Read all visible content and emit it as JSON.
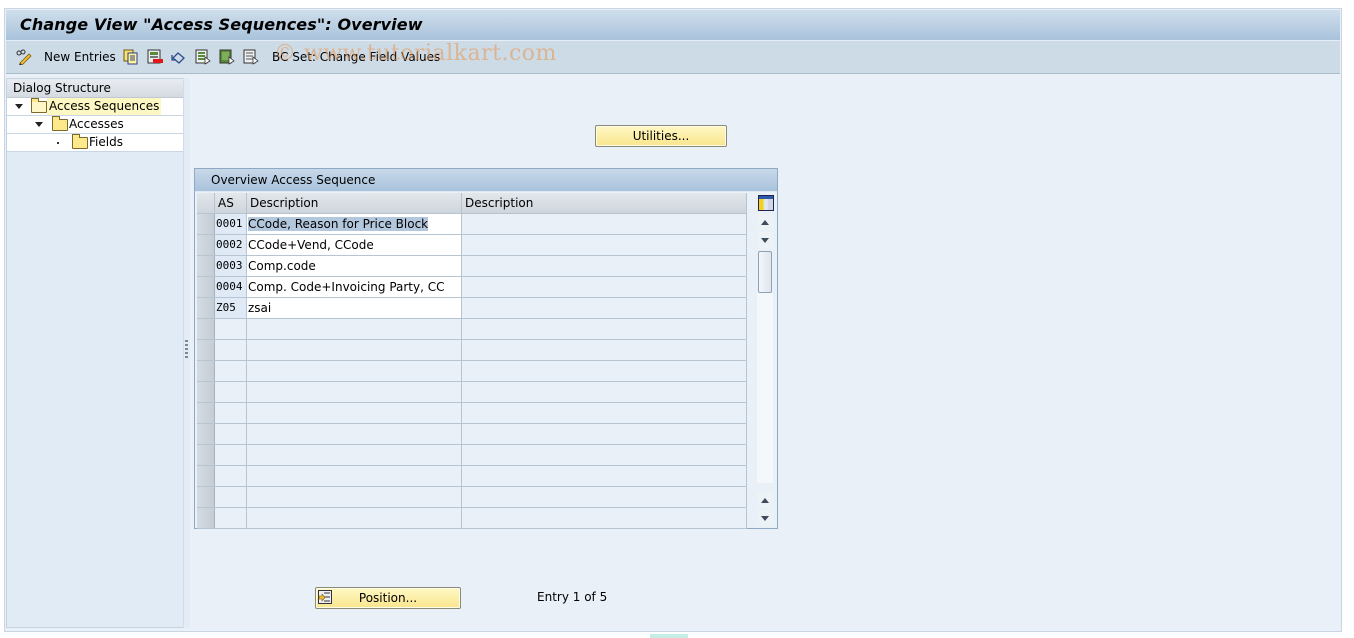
{
  "window": {
    "title": "Change View \"Access Sequences\": Overview"
  },
  "toolbar": {
    "items": [
      {
        "icon": "pencil-glasses-icon",
        "label": ""
      },
      {
        "icon": "new-entries",
        "label": "New Entries"
      },
      {
        "icon": "copy-icon",
        "label": ""
      },
      {
        "icon": "delete-icon",
        "label": ""
      },
      {
        "icon": "undo-icon",
        "label": ""
      },
      {
        "icon": "select-all-icon",
        "label": ""
      },
      {
        "icon": "select-block-icon",
        "label": ""
      },
      {
        "icon": "deselect-all-icon",
        "label": ""
      }
    ],
    "new_entries_label": "New Entries",
    "bc_set_label": "BC Set: Change Field Values",
    "watermark": "© www.tutorialkart.com"
  },
  "dialog_structure": {
    "header": "Dialog Structure",
    "items": [
      {
        "label": "Access Sequences",
        "level": 0,
        "expanded": true,
        "selected": true
      },
      {
        "label": "Accesses",
        "level": 1,
        "expanded": true,
        "selected": false
      },
      {
        "label": "Fields",
        "level": 2,
        "expanded": false,
        "selected": false
      }
    ]
  },
  "utilities_button": "Utilities...",
  "table": {
    "title": "Overview Access Sequence",
    "columns": [
      "AS",
      "Description",
      "Description"
    ],
    "rows": [
      {
        "as": "0001",
        "description": "CCode, Reason for Price Block",
        "description2": "",
        "highlighted": true
      },
      {
        "as": "0002",
        "description": "CCode+Vend, CCode",
        "description2": ""
      },
      {
        "as": "0003",
        "description": "Comp.code",
        "description2": ""
      },
      {
        "as": "0004",
        "description": "Comp. Code+Invoicing Party, CC",
        "description2": ""
      },
      {
        "as": "Z05",
        "description": "zsai",
        "description2": ""
      }
    ],
    "empty_rows": 10
  },
  "position_button": "Position...",
  "entry_status": "Entry 1 of 5"
}
